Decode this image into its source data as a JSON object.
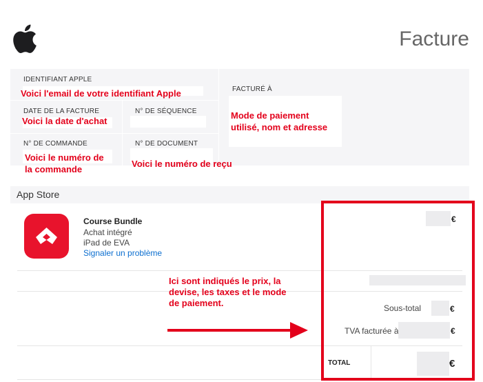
{
  "header": {
    "title": "Facture",
    "logo": "apple-logo"
  },
  "info": {
    "apple_id_label": "IDENTIFIANT APPLE",
    "apple_id_note": "Voici l'email de votre identifiant Apple",
    "invoice_date_label": "DATE DE LA FACTURE",
    "invoice_date_note": "Voici la date d'achat",
    "sequence_label": "N° DE SÉQUENCE",
    "order_label": "N° DE COMMANDE",
    "order_note_1": "Voici le numéro de",
    "order_note_2": "la commande",
    "document_label": "N° DE DOCUMENT",
    "document_note": "Voici le numéro de reçu",
    "billed_to_label": "FACTURÉ À",
    "billed_to_note_1": "Mode de paiement",
    "billed_to_note_2": "utilisé, nom et adresse"
  },
  "section": {
    "title": "App Store"
  },
  "item": {
    "name": "Course Bundle",
    "type": "Achat intégré",
    "device": "iPad de EVA",
    "report_link": "Signaler un problème",
    "icon": "app-icon",
    "price_currency": "€"
  },
  "pricing": {
    "note_1": "Ici sont indiqués le prix, la",
    "note_2": "devise, les taxes et le mode",
    "note_3": "de paiement.",
    "subtotal_label": "Sous-total",
    "subtotal_currency": "€",
    "vat_label": "TVA facturée à",
    "vat_currency": "€",
    "total_label": "TOTAL",
    "total_currency": "€"
  },
  "colors": {
    "annotation": "#e3001b",
    "app_icon": "#e8132c",
    "link": "#0b6ecf"
  }
}
